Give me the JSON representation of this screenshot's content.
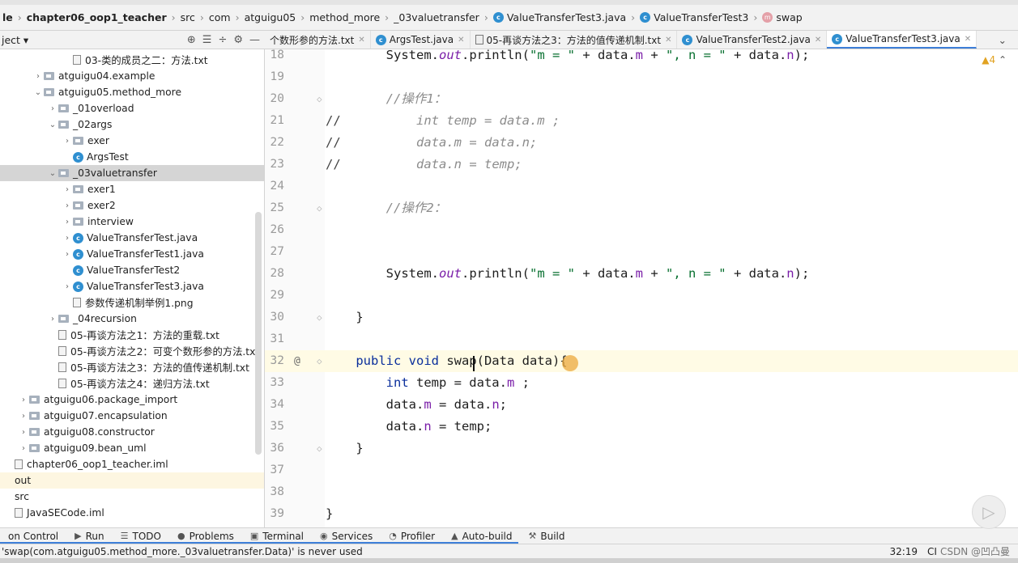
{
  "breadcrumb": [
    "le",
    "chapter06_oop1_teacher",
    "src",
    "com",
    "atguigu05",
    "method_more",
    "_03valuetransfer",
    "ValueTransferTest3.java",
    "ValueTransferTest3",
    "swap"
  ],
  "project_panel": {
    "title": "ject",
    "dropdown": "▾"
  },
  "tabs": [
    {
      "label": "个数形参的方法.txt",
      "icon": "text-file-icon",
      "active": false
    },
    {
      "label": "ArgsTest.java",
      "icon": "class-icon",
      "active": false
    },
    {
      "label": "05-再谈方法之3：方法的值传递机制.txt",
      "icon": "text-file-icon",
      "active": false
    },
    {
      "label": "ValueTransferTest2.java",
      "icon": "class-icon",
      "active": false
    },
    {
      "label": "ValueTransferTest3.java",
      "icon": "class-icon",
      "active": true
    }
  ],
  "tree": [
    {
      "label": "03-类的成员之二：方法.txt",
      "indent": 4,
      "kind": "txt",
      "arrow": ""
    },
    {
      "label": "atguigu04.example",
      "indent": 2,
      "kind": "pkg",
      "arrow": "›"
    },
    {
      "label": "atguigu05.method_more",
      "indent": 2,
      "kind": "pkg",
      "arrow": "⌄"
    },
    {
      "label": "_01overload",
      "indent": 3,
      "kind": "pkg",
      "arrow": "›"
    },
    {
      "label": "_02args",
      "indent": 3,
      "kind": "pkg",
      "arrow": "⌄"
    },
    {
      "label": "exer",
      "indent": 4,
      "kind": "pkg",
      "arrow": "›"
    },
    {
      "label": "ArgsTest",
      "indent": 4,
      "kind": "class",
      "arrow": ""
    },
    {
      "label": "_03valuetransfer",
      "indent": 3,
      "kind": "pkg",
      "arrow": "⌄",
      "selected": true
    },
    {
      "label": "exer1",
      "indent": 4,
      "kind": "pkg",
      "arrow": "›"
    },
    {
      "label": "exer2",
      "indent": 4,
      "kind": "pkg",
      "arrow": "›"
    },
    {
      "label": "interview",
      "indent": 4,
      "kind": "pkg",
      "arrow": "›"
    },
    {
      "label": "ValueTransferTest.java",
      "indent": 4,
      "kind": "class",
      "arrow": "›"
    },
    {
      "label": "ValueTransferTest1.java",
      "indent": 4,
      "kind": "class",
      "arrow": "›"
    },
    {
      "label": "ValueTransferTest2",
      "indent": 4,
      "kind": "class",
      "arrow": ""
    },
    {
      "label": "ValueTransferTest3.java",
      "indent": 4,
      "kind": "class",
      "arrow": "›"
    },
    {
      "label": "参数传递机制举例1.png",
      "indent": 4,
      "kind": "txt",
      "arrow": ""
    },
    {
      "label": "_04recursion",
      "indent": 3,
      "kind": "pkg",
      "arrow": "›"
    },
    {
      "label": "05-再谈方法之1：方法的重载.txt",
      "indent": 3,
      "kind": "txt",
      "arrow": ""
    },
    {
      "label": "05-再谈方法之2：可变个数形参的方法.txt",
      "indent": 3,
      "kind": "txt",
      "arrow": ""
    },
    {
      "label": "05-再谈方法之3：方法的值传递机制.txt",
      "indent": 3,
      "kind": "txt",
      "arrow": ""
    },
    {
      "label": "05-再谈方法之4：递归方法.txt",
      "indent": 3,
      "kind": "txt",
      "arrow": ""
    },
    {
      "label": "atguigu06.package_import",
      "indent": 1,
      "kind": "pkg",
      "arrow": "›"
    },
    {
      "label": "atguigu07.encapsulation",
      "indent": 1,
      "kind": "pkg",
      "arrow": "›"
    },
    {
      "label": "atguigu08.constructor",
      "indent": 1,
      "kind": "pkg",
      "arrow": "›"
    },
    {
      "label": "atguigu09.bean_uml",
      "indent": 1,
      "kind": "pkg",
      "arrow": "›"
    },
    {
      "label": "chapter06_oop1_teacher.iml",
      "indent": 0,
      "kind": "txt",
      "arrow": ""
    },
    {
      "label": "out",
      "indent": 0,
      "kind": "none",
      "arrow": "",
      "highlight": true
    },
    {
      "label": "src",
      "indent": 0,
      "kind": "none",
      "arrow": ""
    },
    {
      "label": "JavaSECode.iml",
      "indent": 0,
      "kind": "txt",
      "arrow": ""
    }
  ],
  "editor": {
    "warnings": "4",
    "lines": [
      {
        "n": "18",
        "html": "        System.<span class='fl it'>out</span>.println(<span class='st'>\"m = \"</span> + data.<span class='fl'>m</span> + <span class='st'>\", n = \"</span> + data.<span class='fl'>n</span>);"
      },
      {
        "n": "19",
        "html": ""
      },
      {
        "n": "20",
        "html": "        <span class='cm'>//操作1：</span>"
      },
      {
        "n": "21",
        "html": "<span class='cmt'>//</span>          <span class='cm'>int temp = data.m ;</span>"
      },
      {
        "n": "22",
        "html": "<span class='cmt'>//</span>          <span class='cm'>data.m = data.n;</span>"
      },
      {
        "n": "23",
        "html": "<span class='cmt'>//</span>          <span class='cm'>data.n = temp;</span>"
      },
      {
        "n": "24",
        "html": ""
      },
      {
        "n": "25",
        "html": "        <span class='cm'>//操作2：</span>"
      },
      {
        "n": "26",
        "html": ""
      },
      {
        "n": "27",
        "html": ""
      },
      {
        "n": "28",
        "html": "        System.<span class='fl it'>out</span>.println(<span class='st'>\"m = \"</span> + data.<span class='fl'>m</span> + <span class='st'>\", n = \"</span> + data.<span class='fl'>n</span>);"
      },
      {
        "n": "29",
        "html": ""
      },
      {
        "n": "30",
        "html": "    }"
      },
      {
        "n": "31",
        "html": ""
      },
      {
        "n": "32",
        "html": "    <span class='kw'>public void</span> swap(Data data){",
        "current": true,
        "marker": "@"
      },
      {
        "n": "33",
        "html": "        <span class='kw'>int</span> temp = data.<span class='fl'>m</span> ;"
      },
      {
        "n": "34",
        "html": "        data.<span class='fl'>m</span> = data.<span class='fl'>n</span>;"
      },
      {
        "n": "35",
        "html": "        data.<span class='fl'>n</span> = temp;"
      },
      {
        "n": "36",
        "html": "    }"
      },
      {
        "n": "37",
        "html": ""
      },
      {
        "n": "38",
        "html": ""
      },
      {
        "n": "39",
        "html": "}"
      }
    ]
  },
  "bottom_tools": [
    {
      "label": "on Control",
      "icon": ""
    },
    {
      "label": "Run",
      "icon": "▶"
    },
    {
      "label": "TODO",
      "icon": "☰"
    },
    {
      "label": "Problems",
      "icon": "●"
    },
    {
      "label": "Terminal",
      "icon": "▣"
    },
    {
      "label": "Services",
      "icon": "◉"
    },
    {
      "label": "Profiler",
      "icon": "◔"
    },
    {
      "label": "Auto-build",
      "icon": "▲"
    },
    {
      "label": "Build",
      "icon": "⚒"
    }
  ],
  "status": {
    "message": "'swap(com.atguigu05.method_more._03valuetransfer.Data)' is never used",
    "position": "32:19",
    "encoding": "CI",
    "watermark": "CSDN @凹凸曼"
  }
}
